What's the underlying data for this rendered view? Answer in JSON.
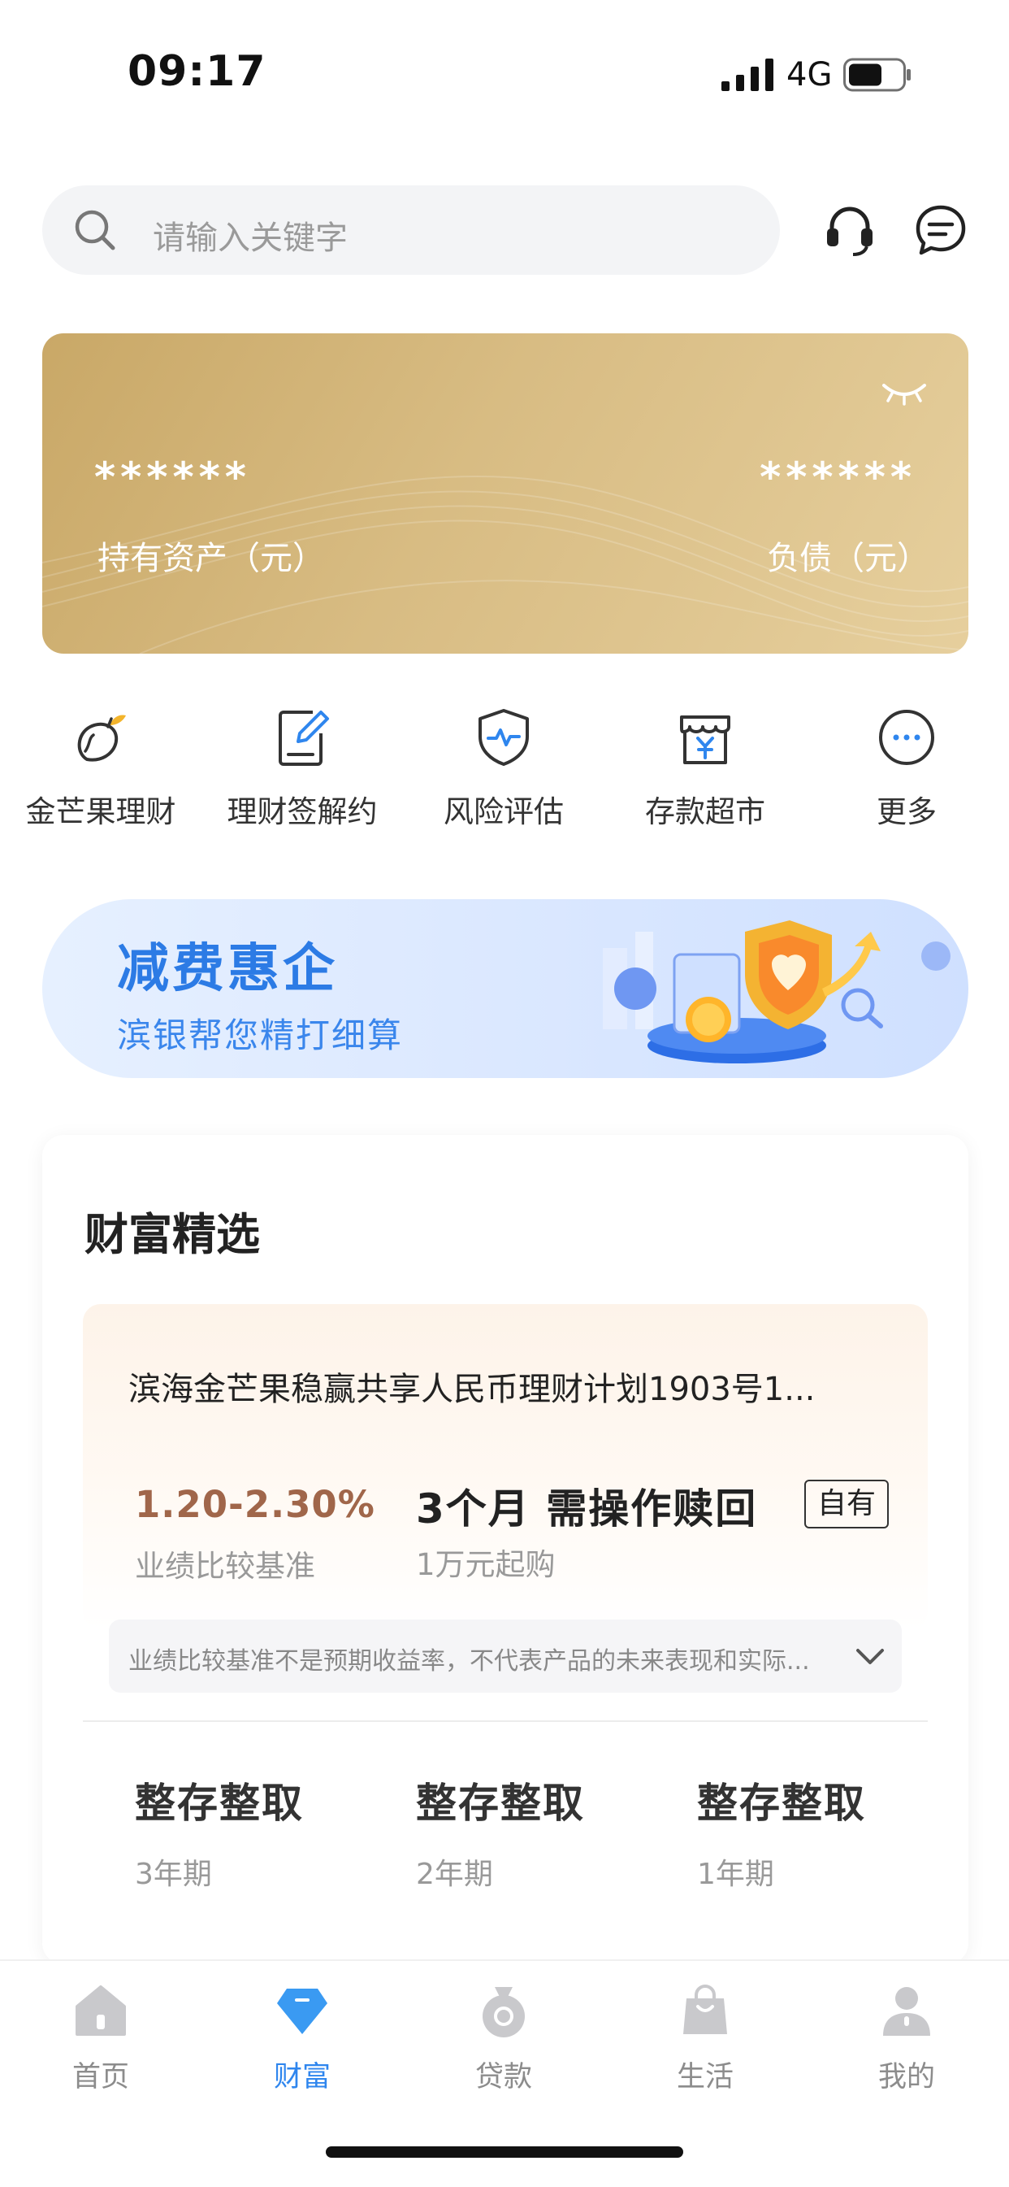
{
  "status_bar": {
    "time": "09:17",
    "network": "4G"
  },
  "search": {
    "placeholder": "请输入关键字"
  },
  "header_icons": [
    "headset-icon",
    "message-icon"
  ],
  "asset_card": {
    "left_value": "******",
    "left_label": "持有资产（元）",
    "right_value": "******",
    "right_label": "负债（元）",
    "visibility_icon": "eye-closed-icon"
  },
  "quick_entries": [
    {
      "label": "金芒果理财",
      "icon": "mango-icon"
    },
    {
      "label": "理财签解约",
      "icon": "sign-document-icon"
    },
    {
      "label": "风险评估",
      "icon": "shield-pulse-icon"
    },
    {
      "label": "存款超市",
      "icon": "store-yuan-icon"
    },
    {
      "label": "更多",
      "icon": "more-icon"
    }
  ],
  "banner": {
    "title": "减费惠企",
    "subtitle": "滨银帮您精打细算"
  },
  "wealth": {
    "title": "财富精选",
    "product": {
      "name": "滨海金芒果稳赢共享人民币理财计划1903号1...",
      "rate": "1.20-2.30%",
      "rate_label": "业绩比较基准",
      "term": "3个月 需操作赎回",
      "min_buy": "1万元起购",
      "tag": "自有",
      "disclaimer": "业绩比较基准不是预期收益率，不代表产品的未来表现和实际..."
    },
    "deposits": [
      {
        "title": "整存整取",
        "term": "3年期"
      },
      {
        "title": "整存整取",
        "term": "2年期"
      },
      {
        "title": "整存整取",
        "term": "1年期"
      }
    ]
  },
  "tabbar": {
    "items": [
      {
        "label": "首页",
        "icon": "home-icon"
      },
      {
        "label": "财富",
        "icon": "diamond-icon",
        "active": true
      },
      {
        "label": "贷款",
        "icon": "money-bag-icon"
      },
      {
        "label": "生活",
        "icon": "shopping-bag-icon"
      },
      {
        "label": "我的",
        "icon": "user-icon"
      }
    ]
  },
  "colors": {
    "accent": "#2f86ee",
    "gold": "#d3b579",
    "rate": "#a0664a"
  }
}
